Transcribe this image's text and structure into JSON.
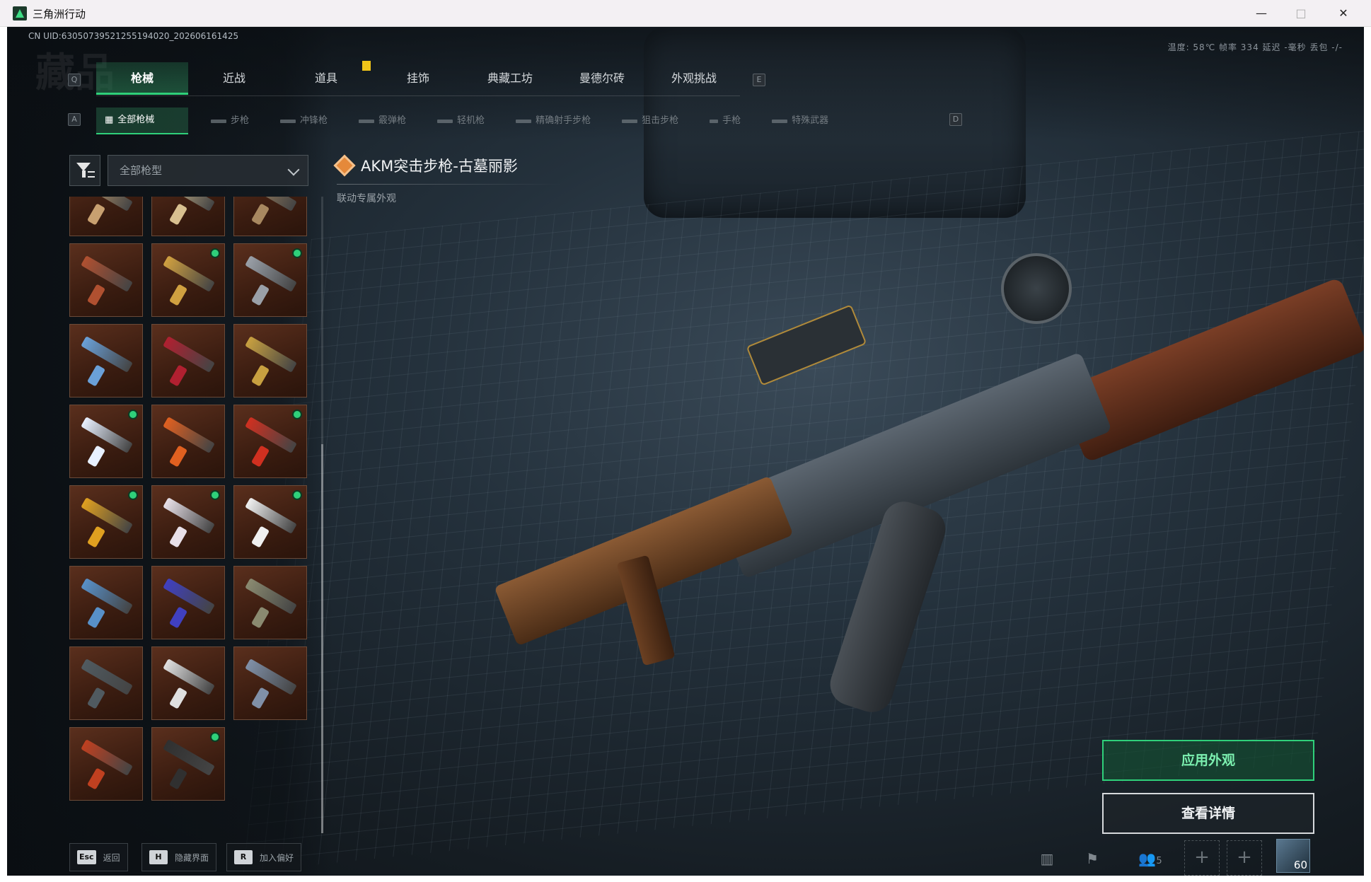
{
  "window": {
    "title": "三角洲行动",
    "controls": {
      "minimize": "—",
      "maximize": "□",
      "close": "✕"
    }
  },
  "hud": {
    "uid": "CN UID:63050739521255194020_202606161425",
    "stats": "温度: 58℃   帧率 334   延迟 -毫秒   丢包 -/-",
    "watermark": "藏品"
  },
  "tabs": {
    "left_key": "Q",
    "right_key": "E",
    "items": [
      {
        "label": "枪械",
        "active": true
      },
      {
        "label": "近战",
        "active": false
      },
      {
        "label": "道具",
        "active": false
      },
      {
        "label": "挂饰",
        "active": false
      },
      {
        "label": "典藏工坊",
        "active": false
      },
      {
        "label": "曼德尔砖",
        "active": false
      },
      {
        "label": "外观挑战",
        "active": false
      }
    ]
  },
  "subtabs": {
    "left_key": "A",
    "right_key": "D",
    "items": [
      {
        "label": "全部枪械",
        "active": true
      },
      {
        "label": "步枪",
        "active": false
      },
      {
        "label": "冲锋枪",
        "active": false
      },
      {
        "label": "霰弹枪",
        "active": false
      },
      {
        "label": "轻机枪",
        "active": false
      },
      {
        "label": "精确射手步枪",
        "active": false
      },
      {
        "label": "狙击步枪",
        "active": false
      },
      {
        "label": "手枪",
        "active": false
      },
      {
        "label": "特殊武器",
        "active": false
      }
    ]
  },
  "filter": {
    "dropdown_value": "全部枪型"
  },
  "item": {
    "title": "AKM突击步枪-古墓丽影",
    "subtitle": "联动专属外观"
  },
  "skins": [
    {
      "color": "#c8a070",
      "owned_new": false
    },
    {
      "color": "#d8c090",
      "owned_new": false
    },
    {
      "color": "#a88860",
      "owned_new": false
    },
    {
      "color": "#b05030",
      "owned_new": false
    },
    {
      "color": "#d0a040",
      "owned_new": true
    },
    {
      "color": "#9aa0a8",
      "owned_new": true
    },
    {
      "color": "#6aa0d8",
      "owned_new": false
    },
    {
      "color": "#b02030",
      "owned_new": false
    },
    {
      "color": "#c8a040",
      "owned_new": false
    },
    {
      "color": "#e8f0ff",
      "owned_new": true
    },
    {
      "color": "#e06020",
      "owned_new": false
    },
    {
      "color": "#d03020",
      "owned_new": true
    },
    {
      "color": "#e0a020",
      "owned_new": true
    },
    {
      "color": "#e8e0e8",
      "owned_new": true
    },
    {
      "color": "#f0f0f0",
      "owned_new": true
    },
    {
      "color": "#5890c8",
      "owned_new": false
    },
    {
      "color": "#4040c0",
      "owned_new": false
    },
    {
      "color": "#8a8a70",
      "owned_new": false
    },
    {
      "color": "#505a60",
      "owned_new": false
    },
    {
      "color": "#e0e0e0",
      "owned_new": false
    },
    {
      "color": "#8090a8",
      "owned_new": false
    },
    {
      "color": "#c04020",
      "owned_new": false
    },
    {
      "color": "#303030",
      "owned_new": true
    }
  ],
  "actions": {
    "apply": "应用外观",
    "details": "查看详情"
  },
  "hints": [
    {
      "key": "Esc",
      "label": "返回"
    },
    {
      "key": "H",
      "label": "隐藏界面"
    },
    {
      "key": "R",
      "label": "加入偏好"
    }
  ],
  "bottom_right": {
    "team_count": "5",
    "slot_add": "+",
    "avatar_level": "60"
  }
}
